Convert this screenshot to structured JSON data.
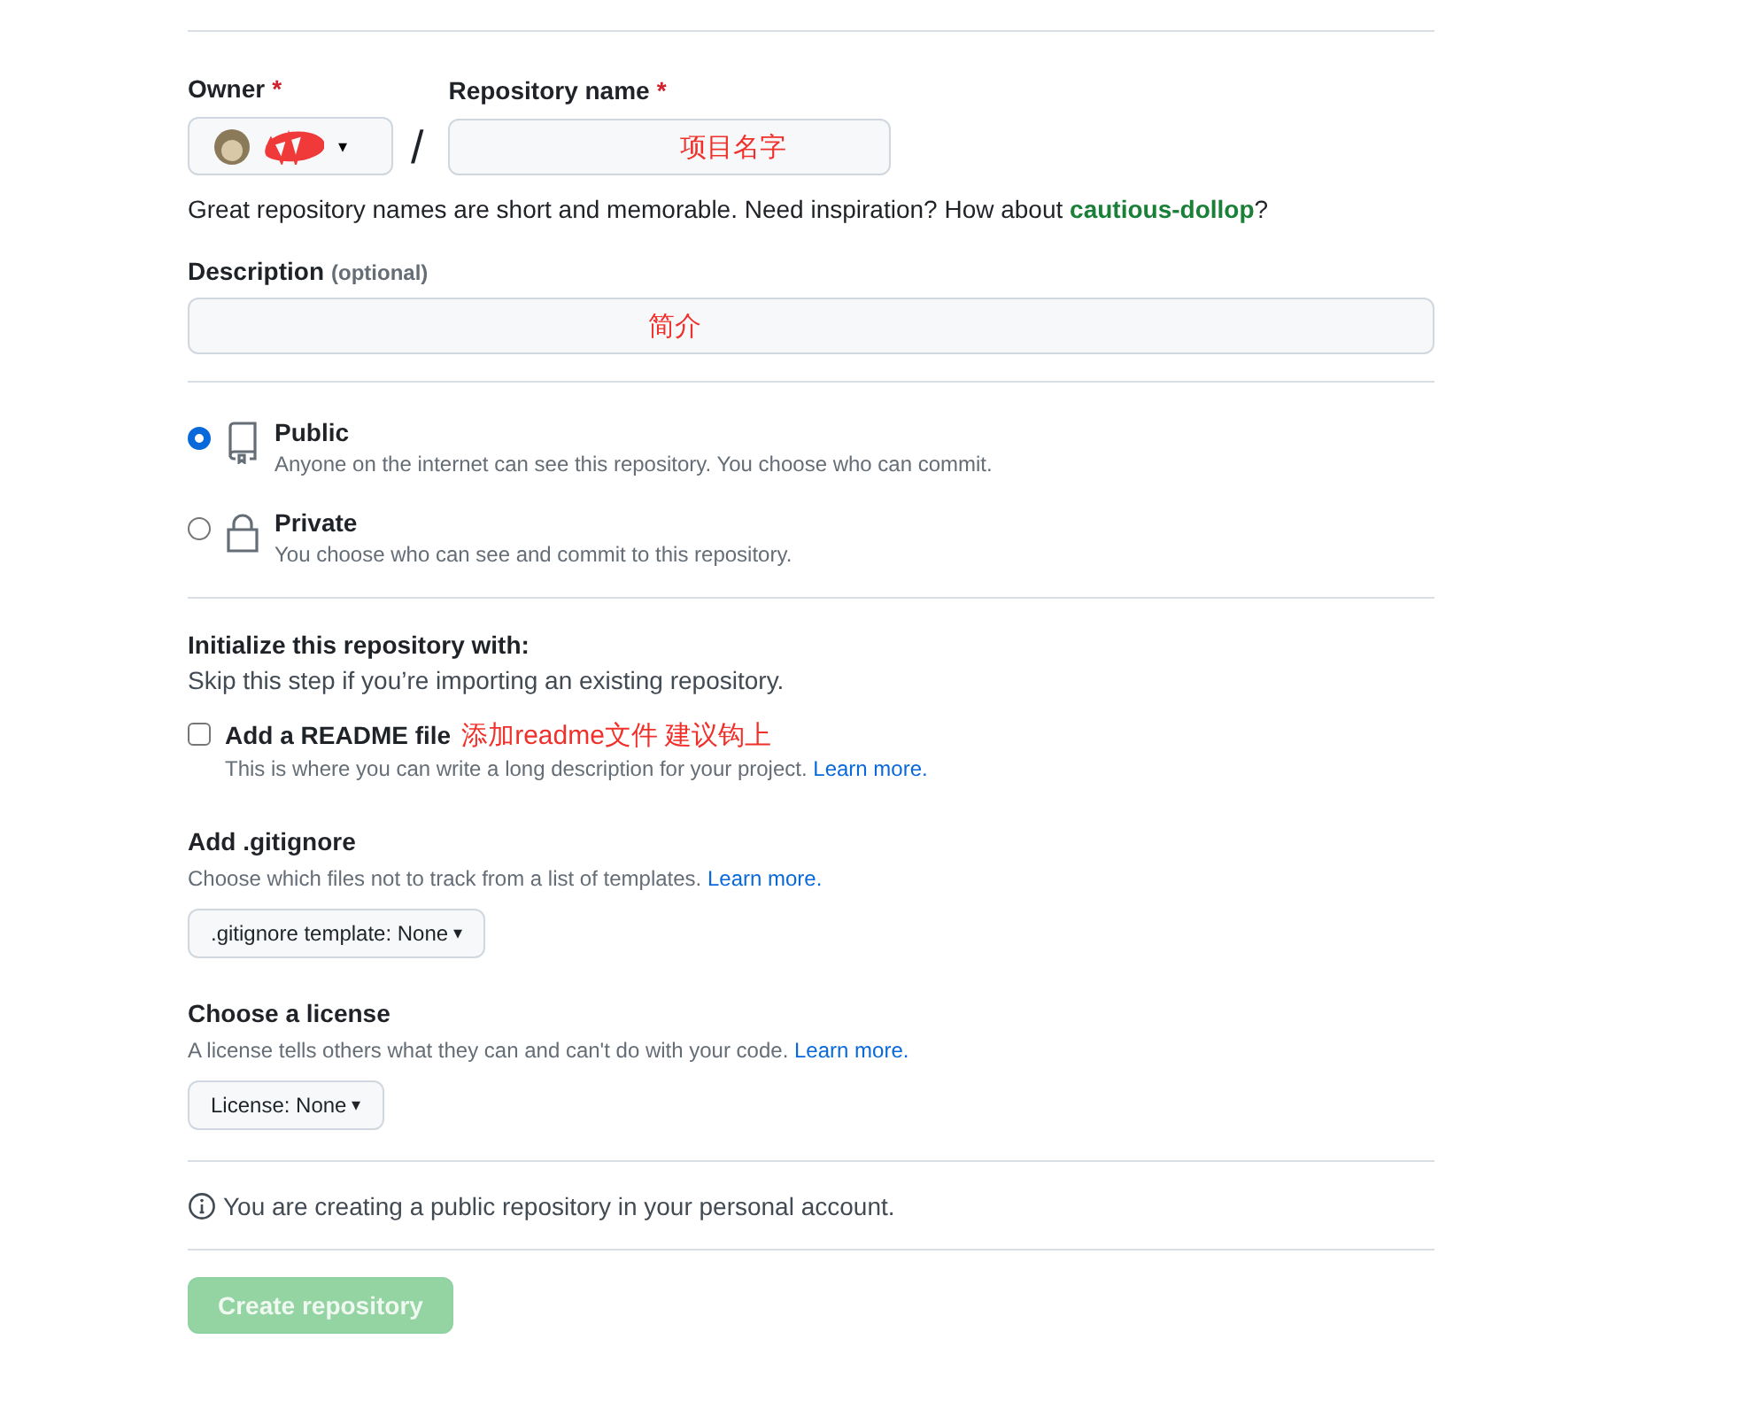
{
  "owner": {
    "label": "Owner",
    "required_mark": "*",
    "redacted": true,
    "caret": "▾"
  },
  "separator": "/",
  "repo_name": {
    "label": "Repository name",
    "required_mark": "*",
    "annotation": "项目名字"
  },
  "name_hint": {
    "text": "Great repository names are short and memorable. Need inspiration? How about ",
    "suggestion": "cautious-dollop",
    "end": "?"
  },
  "description": {
    "label": "Description",
    "note": "(optional)",
    "annotation": "简介"
  },
  "visibility": [
    {
      "kind": "repo",
      "title": "Public",
      "text": "Anyone on the internet can see this repository. You choose who can commit.",
      "selected": true
    },
    {
      "kind": "lock",
      "title": "Private",
      "text": "You choose who can see and commit to this repository.",
      "selected": false
    }
  ],
  "initialize": {
    "title": "Initialize this repository with:",
    "text": "Skip this step if you’re importing an existing repository."
  },
  "readme": {
    "label": "Add a README file",
    "checked": false,
    "annotation": "添加readme文件 建议钩上",
    "text": "This is where you can write a long description for your project. ",
    "link": "Learn more."
  },
  "gitignore": {
    "title": "Add .gitignore",
    "text": "Choose which files not to track from a list of templates. ",
    "link": "Learn more.",
    "button": ".gitignore template: None",
    "caret": "▾"
  },
  "license": {
    "title": "Choose a license",
    "text": "A license tells others what they can and can't do with your code. ",
    "link": "Learn more.",
    "button": "License: None",
    "caret": "▾"
  },
  "notice": "You are creating a public repository in your personal account.",
  "create_button": {
    "label": "Create repository",
    "disabled": true
  }
}
